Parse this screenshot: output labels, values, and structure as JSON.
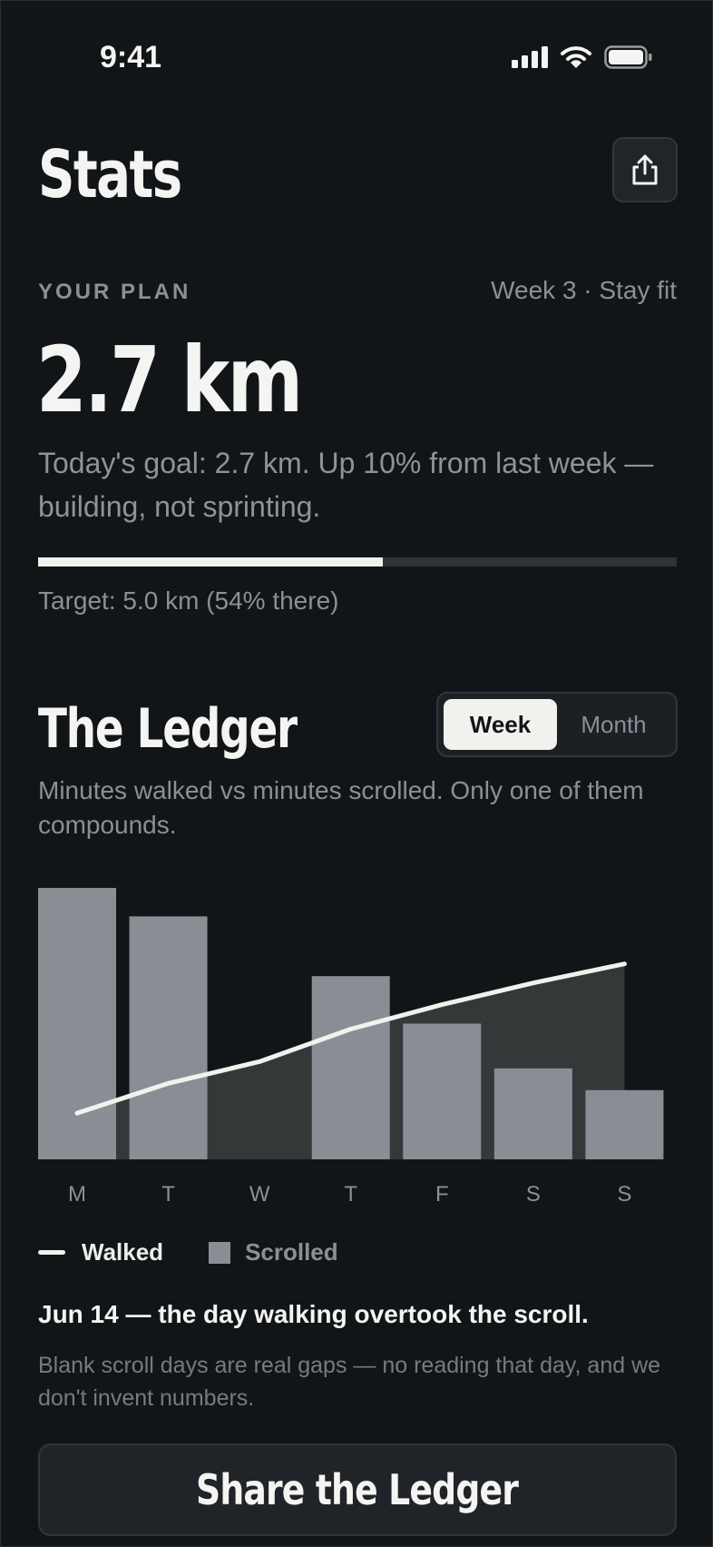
{
  "status_bar": {
    "time": "9:41"
  },
  "header": {
    "title": "Stats"
  },
  "plan": {
    "label": "YOUR PLAN",
    "week": "Week 3 · Stay fit",
    "value": "2.7 km",
    "description": "Today's goal: 2.7 km. Up 10% from last week — building, not sprinting.",
    "progress_fraction": 0.54,
    "target_caption": "Target: 5.0 km (54% there)"
  },
  "ledger": {
    "title": "The Ledger",
    "toggle": {
      "options": [
        "Week",
        "Month"
      ],
      "selected": "Week"
    },
    "description": "Minutes walked vs minutes scrolled. Only one of them compounds.",
    "legend": {
      "walked": "Walked",
      "scrolled": "Scrolled"
    },
    "callout": "Jun 14 — the day walking overtook the scroll.",
    "note": "Blank scroll days are real gaps — no reading that day, and we don't invent numbers."
  },
  "chart_data": {
    "type": "bar",
    "categories": [
      "M",
      "T",
      "W",
      "T",
      "F",
      "S",
      "S"
    ],
    "series": [
      {
        "name": "Scrolled",
        "type": "bar",
        "values": [
          100,
          89.5,
          null,
          67.5,
          50,
          33.5,
          25.5
        ]
      },
      {
        "name": "Walked",
        "type": "line",
        "values": [
          17,
          28,
          36,
          48,
          57,
          65,
          72
        ]
      }
    ],
    "ylim": [
      0,
      100
    ],
    "colors": {
      "walked": "#F1F2EE",
      "scrolled": "#8A8E94",
      "walked_area": "#353839"
    }
  },
  "footer": {
    "share_label": "Share the Ledger"
  }
}
